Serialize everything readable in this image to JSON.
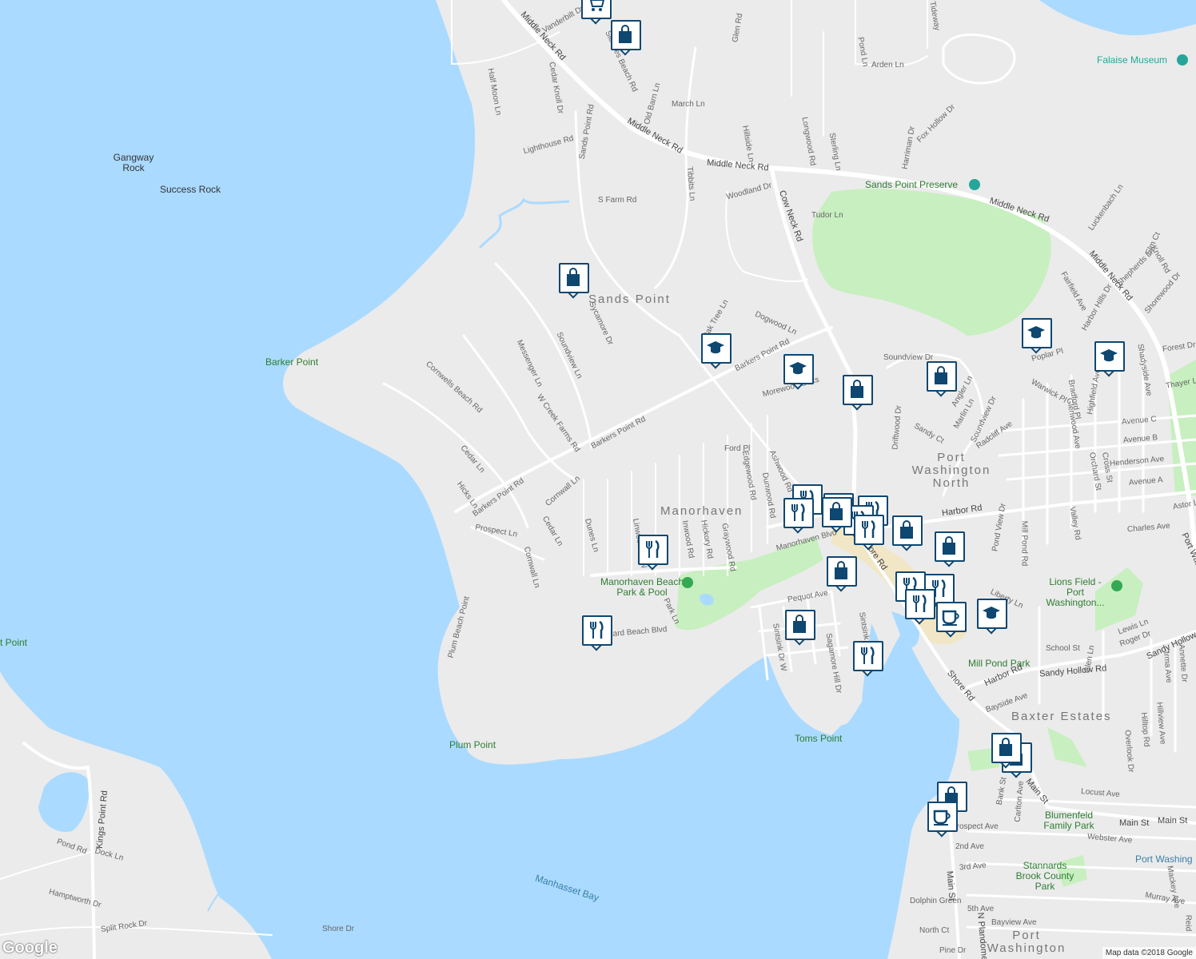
{
  "colors": {
    "land": "#ebebeb",
    "water": "#aadaff",
    "park": "#c8efc0",
    "road": "#ffffff",
    "marker_border": "#0e4770",
    "poi_teal": "#26a69a",
    "poi_green": "#34a853",
    "label_green": "#2e7d32"
  },
  "map": {
    "areas": [
      {
        "id": "sands-point",
        "name": "Sands Point"
      },
      {
        "id": "manorhaven",
        "name": "Manorhaven"
      },
      {
        "id": "port-washington-north",
        "name": "Port Washington North"
      },
      {
        "id": "baxter-estates",
        "name": "Baxter Estates"
      },
      {
        "id": "port-washington",
        "name": "Port Washington"
      }
    ],
    "parks": [
      {
        "id": "manorhaven-beach-park",
        "name": "Manorhaven Beach Park & Pool",
        "icon": "park-icon"
      },
      {
        "id": "lions-field",
        "name": "Lions Field - Port Washington...",
        "icon": "park-icon"
      },
      {
        "id": "mill-pond-park",
        "name": "Mill Pond Park"
      },
      {
        "id": "blumenfeld",
        "name": "Blumenfeld Family Park"
      },
      {
        "id": "stannards-brook",
        "name": "Stannards Brook County Park"
      },
      {
        "id": "sands-point-preserve",
        "name": "Sands Point Preserve",
        "icon": "preserve-icon"
      }
    ],
    "points": [
      {
        "id": "barker-point",
        "name": "Barker Point"
      },
      {
        "id": "plum-point",
        "name": "Plum Point"
      },
      {
        "id": "toms-point",
        "name": "Toms Point"
      },
      {
        "id": "gangway-rock",
        "name": "Gangway Rock"
      },
      {
        "id": "success-rock",
        "name": "Success Rock"
      },
      {
        "id": "falaise-museum",
        "name": "Falaise Museum",
        "icon": "museum-icon"
      },
      {
        "id": "point-left",
        "name": "t Point"
      },
      {
        "id": "port-washington-right",
        "name": "Port Washing"
      }
    ],
    "water_labels": [
      {
        "id": "manhasset-bay",
        "name": "Manhasset Bay"
      }
    ],
    "streets": [
      "Middle Neck Rd",
      "Middle Neck Rd",
      "Middle Neck Rd",
      "Middle Neck Rd",
      "Middle Neck Rd",
      "Cow Neck Rd",
      "Barkers Point Rd",
      "Barkers Point Rd",
      "Barkers Point Rd",
      "Sands Point Rd",
      "Soundview Ln",
      "Sycamore Dr",
      "Messenger Ln",
      "W Creek Farms Rd",
      "Cornwells Beach Rd",
      "Cedar Ln",
      "Hicks Ln",
      "Prospect Ln",
      "Cornwall Ln",
      "Cornwall Ln",
      "Cedar Ln",
      "Dunes Ln",
      "Linwood Rd N",
      "Inwood Rd",
      "Hickory Rd",
      "Graywood Rd",
      "Edgewood Rd",
      "Dunwood Rd",
      "Ashwood Rd",
      "Ford Pl",
      "Morewood Oaks",
      "Oak Tree Ln",
      "Dogwood Ln",
      "Tibbits Ln",
      "Woodland Dr",
      "Tudor Ln",
      "S Farm Rd",
      "Lighthouse Rd",
      "Cedar Knoll Dr",
      "Half Moon Ln",
      "Vanderbilt Dr",
      "Sloanes Beach Rd",
      "Old Barn Ln",
      "March Ln",
      "Hillside Ln",
      "Longwood Rd",
      "Sterling Ln",
      "Harriman Dr",
      "Fox Hollow Dr",
      "Pond Ln",
      "Arden Ln",
      "Glen Rd",
      "Tideway",
      "Soundview Dr",
      "Driftwood Dr",
      "Sandy Ct",
      "Angler Ln",
      "Marlin Ln",
      "Soundview Dr",
      "Radcliff Ave",
      "Manorhaven Blvd",
      "Shore Rd",
      "Shore Rd",
      "Pequot Ave",
      "Sintsink Dr W",
      "Sagamore Hill Dr",
      "Sintsink Dr",
      "Park Ln",
      "Orchard Beach Blvd",
      "Harbor Rd",
      "Harbor Rd",
      "Sandy Hollow Rd",
      "Sandy Hollow",
      "School St",
      "Glen Ln",
      "Roger Dr",
      "Lewis Ln",
      "Liberty Ln",
      "Pond View Dr",
      "Mill Pond Rd",
      "Bayside Ave",
      "Main St",
      "Main St",
      "Main St",
      "Main St",
      "N Plandome Rd",
      "Locust Ave",
      "Webster Ave",
      "2nd Ave",
      "3rd Ave",
      "5th Ave",
      "Bayview Ave",
      "Murray Ave",
      "North Ct",
      "Dolphin Green",
      "Pine Dr",
      "Prospect Ave",
      "Carlton Ave",
      "Bank St",
      "Hilltop Rd",
      "Overlook Dr",
      "Hillview Ave",
      "Irma Ave",
      "Annette Dr",
      "Mackey Ave",
      "Reid",
      "Harbor Hills Dr",
      "Fairfield Ave",
      "Shepherds Ln",
      "Luckenbach Ln",
      "Elm Ct",
      "Knoll Rd",
      "Shorewood Dr",
      "Forest Dr",
      "Thayer Ln",
      "Avenue C",
      "Avenue B",
      "Avenue A",
      "Henderson Ave",
      "Charles Ave",
      "Astor Ln",
      "Port Washington Blvd",
      "Glenwood Ave",
      "Orchard St",
      "Cross St",
      "Valley Rd",
      "Warwick Pl",
      "Highfield Ave",
      "Shadyside Ave",
      "Kings Point Rd",
      "Pond Rd",
      "Dock Ln",
      "Hamptworth Dr",
      "Split Rock Dr",
      "Shore Dr",
      "Plum Beach Point",
      "Poplar Pl",
      "Bradford Pl"
    ],
    "markers": [
      {
        "type": "shop",
        "icon": "shopping-bag-icon"
      },
      {
        "type": "shop",
        "icon": "shopping-bag-icon"
      },
      {
        "type": "shop",
        "icon": "shopping-bag-icon"
      },
      {
        "type": "school",
        "icon": "graduation-cap-icon"
      },
      {
        "type": "school",
        "icon": "graduation-cap-icon"
      },
      {
        "type": "shop",
        "icon": "shopping-bag-icon"
      },
      {
        "type": "shop",
        "icon": "shopping-bag-icon"
      },
      {
        "type": "school",
        "icon": "graduation-cap-icon"
      },
      {
        "type": "school",
        "icon": "graduation-cap-icon"
      },
      {
        "type": "restaurant",
        "icon": "fork-knife-icon"
      },
      {
        "type": "restaurant",
        "icon": "fork-knife-icon"
      },
      {
        "type": "restaurant",
        "icon": "fork-knife-icon"
      },
      {
        "type": "restaurant",
        "icon": "fork-knife-icon"
      },
      {
        "type": "restaurant",
        "icon": "fork-knife-icon"
      },
      {
        "type": "restaurant",
        "icon": "fork-knife-icon"
      },
      {
        "type": "shop",
        "icon": "shopping-bag-icon"
      },
      {
        "type": "shop",
        "icon": "shopping-bag-icon"
      },
      {
        "type": "restaurant",
        "icon": "fork-knife-icon"
      },
      {
        "type": "shop",
        "icon": "shopping-bag-icon"
      },
      {
        "type": "restaurant",
        "icon": "fork-knife-icon"
      },
      {
        "type": "restaurant",
        "icon": "fork-knife-icon"
      },
      {
        "type": "restaurant",
        "icon": "fork-knife-icon"
      },
      {
        "type": "cafe",
        "icon": "coffee-cup-icon"
      },
      {
        "type": "school",
        "icon": "graduation-cap-icon"
      },
      {
        "type": "shop",
        "icon": "shopping-bag-icon"
      },
      {
        "type": "shop",
        "icon": "shopping-bag-icon"
      },
      {
        "type": "restaurant",
        "icon": "fork-knife-icon"
      },
      {
        "type": "shop",
        "icon": "shopping-bag-icon"
      },
      {
        "type": "shop",
        "icon": "shopping-bag-icon"
      },
      {
        "type": "cafe",
        "icon": "coffee-cup-icon"
      },
      {
        "type": "cart",
        "icon": "shopping-cart-icon"
      }
    ]
  },
  "attribution": {
    "text": "Map data ©2018 Google",
    "logo": "Google"
  }
}
